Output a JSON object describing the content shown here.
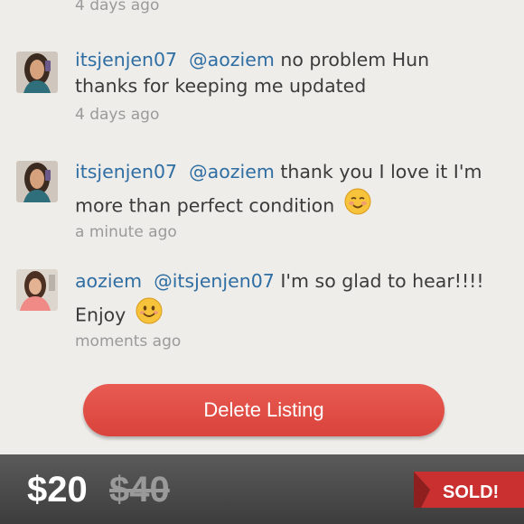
{
  "comments_header": {
    "previous_time": "4 days ago"
  },
  "comments": [
    {
      "username": "itsjenjen07",
      "mention": "@aoziem",
      "text_line1": "no problem Hun",
      "text_line2": "thanks for keeping me updated",
      "time": "4 days ago"
    },
    {
      "username": "itsjenjen07",
      "mention": "@aoziem",
      "text_line1": "thank you I love it I'm",
      "text_line2": "more than perfect condition",
      "emoji": "smiling-blush-emoji",
      "time": "a minute ago"
    },
    {
      "username": "aoziem",
      "mention": "@itsjenjen07",
      "text_line1": "I'm so glad to hear!!!!",
      "text_line2": "Enjoy",
      "emoji": "smiling-emoji",
      "time": "moments ago"
    }
  ],
  "actions": {
    "delete_label": "Delete Listing"
  },
  "footer": {
    "price": "$20",
    "original_price": "$40",
    "status_label": "SOLD!"
  },
  "colors": {
    "accent_red": "#de4a41",
    "link_blue": "#2f6ea3",
    "footer_bg": "#454545"
  }
}
